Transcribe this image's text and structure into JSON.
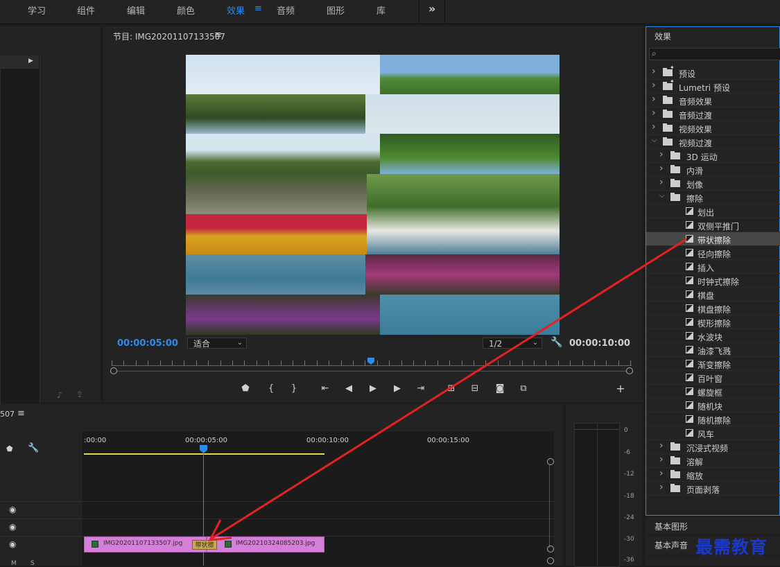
{
  "workspaces": [
    "学习",
    "组件",
    "编辑",
    "颜色",
    "效果",
    "音频",
    "图形",
    "库"
  ],
  "active_workspace": "效果",
  "monitor": {
    "title": "节目: IMG20201107133507",
    "timecode_current": "00:00:05:00",
    "timecode_duration": "00:00:10:00",
    "fit_label": "适合",
    "resolution_label": "1/2"
  },
  "effects": {
    "title": "效果",
    "items": [
      {
        "label": "预设",
        "type": "preset-folder",
        "depth": 0,
        "expanded": false
      },
      {
        "label": "Lumetri 预设",
        "type": "preset-folder",
        "depth": 0,
        "expanded": false
      },
      {
        "label": "音频效果",
        "type": "folder",
        "depth": 0,
        "expanded": false
      },
      {
        "label": "音频过渡",
        "type": "folder",
        "depth": 0,
        "expanded": false
      },
      {
        "label": "视频效果",
        "type": "folder",
        "depth": 0,
        "expanded": false
      },
      {
        "label": "视频过渡",
        "type": "folder",
        "depth": 0,
        "expanded": true
      },
      {
        "label": "3D 运动",
        "type": "folder",
        "depth": 1,
        "expanded": false
      },
      {
        "label": "内滑",
        "type": "folder",
        "depth": 1,
        "expanded": false
      },
      {
        "label": "划像",
        "type": "folder",
        "depth": 1,
        "expanded": false
      },
      {
        "label": "擦除",
        "type": "folder",
        "depth": 1,
        "expanded": true
      },
      {
        "label": "划出",
        "type": "effect",
        "depth": 2
      },
      {
        "label": "双侧平推门",
        "type": "effect",
        "depth": 2
      },
      {
        "label": "带状擦除",
        "type": "effect",
        "depth": 2,
        "selected": true
      },
      {
        "label": "径向擦除",
        "type": "effect",
        "depth": 2
      },
      {
        "label": "插入",
        "type": "effect",
        "depth": 2
      },
      {
        "label": "时钟式擦除",
        "type": "effect",
        "depth": 2
      },
      {
        "label": "棋盘",
        "type": "effect",
        "depth": 2
      },
      {
        "label": "棋盘擦除",
        "type": "effect",
        "depth": 2
      },
      {
        "label": "楔形擦除",
        "type": "effect",
        "depth": 2
      },
      {
        "label": "水波块",
        "type": "effect",
        "depth": 2
      },
      {
        "label": "油漆飞溅",
        "type": "effect",
        "depth": 2
      },
      {
        "label": "渐变擦除",
        "type": "effect",
        "depth": 2
      },
      {
        "label": "百叶窗",
        "type": "effect",
        "depth": 2
      },
      {
        "label": "螺旋框",
        "type": "effect",
        "depth": 2
      },
      {
        "label": "随机块",
        "type": "effect",
        "depth": 2
      },
      {
        "label": "随机擦除",
        "type": "effect",
        "depth": 2
      },
      {
        "label": "风车",
        "type": "effect",
        "depth": 2
      },
      {
        "label": "沉浸式视频",
        "type": "folder",
        "depth": 1,
        "expanded": false
      },
      {
        "label": "溶解",
        "type": "folder",
        "depth": 1,
        "expanded": false
      },
      {
        "label": "缩放",
        "type": "folder",
        "depth": 1,
        "expanded": false
      },
      {
        "label": "页面剥落",
        "type": "folder",
        "depth": 1,
        "expanded": false
      }
    ]
  },
  "lower_tabs": {
    "basic_graphics": "基本图形",
    "basic_sound": "基本声音"
  },
  "timeline": {
    "title": "507",
    "times": [
      ":00:00",
      "00:00:05:00",
      "00:00:10:00",
      "00:00:15:00"
    ],
    "clip1": "IMG20201107133507.jpg",
    "clip2": "IMG20210324085203.jpg",
    "transition_label": "带状擦"
  },
  "meter_db": [
    "0",
    "-6",
    "-12",
    "-18",
    "-24",
    "-30",
    "-36"
  ],
  "watermark": "最需教育",
  "accent_color": "#2d8ceb",
  "clip_color": "#d580d8",
  "annotation_color": "#e52222"
}
